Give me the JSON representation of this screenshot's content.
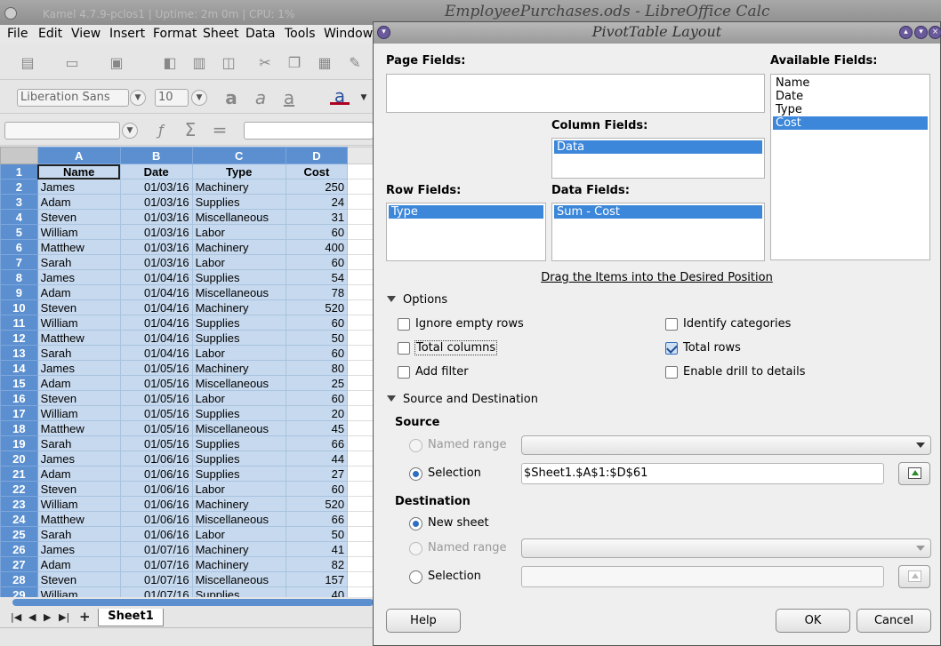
{
  "calc": {
    "window_title": "EmployeePurchases.ods - LibreOffice Calc",
    "system_bar": "Kamel 4.7.9-pclos1 | Uptime: 2m 0m | CPU: 1%",
    "menu": [
      "File",
      "Edit",
      "View",
      "Insert",
      "Format",
      "Sheet",
      "Data",
      "Tools",
      "Window"
    ],
    "font_name": "Liberation Sans",
    "font_size": "10",
    "columns": [
      "A",
      "B",
      "C",
      "D"
    ],
    "header_row": [
      "Name",
      "Date",
      "Type",
      "Cost"
    ],
    "rows": [
      [
        "2",
        "James",
        "01/03/16",
        "Machinery",
        "250"
      ],
      [
        "3",
        "Adam",
        "01/03/16",
        "Supplies",
        "24"
      ],
      [
        "4",
        "Steven",
        "01/03/16",
        "Miscellaneous",
        "31"
      ],
      [
        "5",
        "William",
        "01/03/16",
        "Labor",
        "60"
      ],
      [
        "6",
        "Matthew",
        "01/03/16",
        "Machinery",
        "400"
      ],
      [
        "7",
        "Sarah",
        "01/03/16",
        "Labor",
        "60"
      ],
      [
        "8",
        "James",
        "01/04/16",
        "Supplies",
        "54"
      ],
      [
        "9",
        "Adam",
        "01/04/16",
        "Miscellaneous",
        "78"
      ],
      [
        "10",
        "Steven",
        "01/04/16",
        "Machinery",
        "520"
      ],
      [
        "11",
        "William",
        "01/04/16",
        "Supplies",
        "60"
      ],
      [
        "12",
        "Matthew",
        "01/04/16",
        "Supplies",
        "50"
      ],
      [
        "13",
        "Sarah",
        "01/04/16",
        "Labor",
        "60"
      ],
      [
        "14",
        "James",
        "01/05/16",
        "Machinery",
        "80"
      ],
      [
        "15",
        "Adam",
        "01/05/16",
        "Miscellaneous",
        "25"
      ],
      [
        "16",
        "Steven",
        "01/05/16",
        "Labor",
        "60"
      ],
      [
        "17",
        "William",
        "01/05/16",
        "Supplies",
        "20"
      ],
      [
        "18",
        "Matthew",
        "01/05/16",
        "Miscellaneous",
        "45"
      ],
      [
        "19",
        "Sarah",
        "01/05/16",
        "Supplies",
        "66"
      ],
      [
        "20",
        "James",
        "01/06/16",
        "Supplies",
        "44"
      ],
      [
        "21",
        "Adam",
        "01/06/16",
        "Supplies",
        "27"
      ],
      [
        "22",
        "Steven",
        "01/06/16",
        "Labor",
        "60"
      ],
      [
        "23",
        "William",
        "01/06/16",
        "Machinery",
        "520"
      ],
      [
        "24",
        "Matthew",
        "01/06/16",
        "Miscellaneous",
        "66"
      ],
      [
        "25",
        "Sarah",
        "01/06/16",
        "Labor",
        "50"
      ],
      [
        "26",
        "James",
        "01/07/16",
        "Machinery",
        "41"
      ],
      [
        "27",
        "Adam",
        "01/07/16",
        "Machinery",
        "82"
      ],
      [
        "28",
        "Steven",
        "01/07/16",
        "Miscellaneous",
        "157"
      ],
      [
        "29",
        "William",
        "01/07/16",
        "Supplies",
        "40"
      ]
    ],
    "sheet_tab": "Sheet1"
  },
  "dialog": {
    "title": "PivotTable Layout",
    "page_fields_label": "Page Fields:",
    "available_fields_label": "Available Fields:",
    "available_fields": [
      "Name",
      "Date",
      "Type",
      "Cost"
    ],
    "available_selected": "Cost",
    "column_fields_label": "Column Fields:",
    "column_fields": [
      "Data"
    ],
    "row_fields_label": "Row Fields:",
    "row_fields": [
      "Type"
    ],
    "data_fields_label": "Data Fields:",
    "data_fields": [
      "Sum - Cost"
    ],
    "drag_hint": "Drag the Items into the Desired Position",
    "options_label": "Options",
    "options": {
      "ignore_empty_rows": {
        "label": "Ignore empty rows",
        "checked": false
      },
      "identify_categories": {
        "label": "Identify categories",
        "checked": false
      },
      "total_columns": {
        "label": "Total columns",
        "checked": false
      },
      "total_rows": {
        "label": "Total rows",
        "checked": true
      },
      "add_filter": {
        "label": "Add filter",
        "checked": false
      },
      "enable_drill": {
        "label": "Enable drill to details",
        "checked": false
      }
    },
    "source_dest_label": "Source and Destination",
    "source_label": "Source",
    "source_named_range": "Named range",
    "source_selection": "Selection",
    "source_selection_value": "$Sheet1.$A$1:$D$61",
    "destination_label": "Destination",
    "dest_new_sheet": "New sheet",
    "dest_named_range": "Named range",
    "dest_selection": "Selection",
    "dest_selection_value": "",
    "help_button": "Help",
    "ok_button": "OK",
    "cancel_button": "Cancel"
  },
  "colors": {
    "selection": "#3c87d9",
    "header_blue": "#5b8fcf",
    "cell_selected": "#c6d9ee"
  }
}
